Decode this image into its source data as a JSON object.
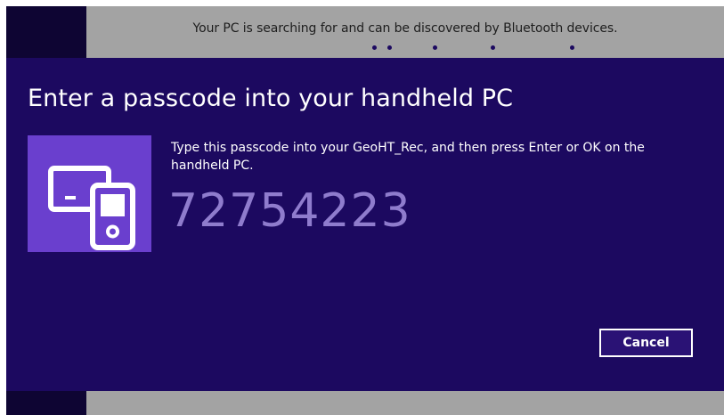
{
  "status_bar": {
    "message": "Your PC is searching for and can be discovered by Bluetooth devices."
  },
  "dialog": {
    "title": "Enter a passcode into your handheld PC",
    "device_icon": "tablet-and-handheld-device-icon",
    "instruction": "Type this passcode into your GeoHT_Rec, and then press Enter or OK on the handheld PC.",
    "passcode": "72754223",
    "cancel_label": "Cancel"
  },
  "colors": {
    "dialog_background": "#1c0960",
    "tile_background": "#6a3fce",
    "passcode_text": "#8f7ccd",
    "bar_background": "#a3a3a3"
  }
}
